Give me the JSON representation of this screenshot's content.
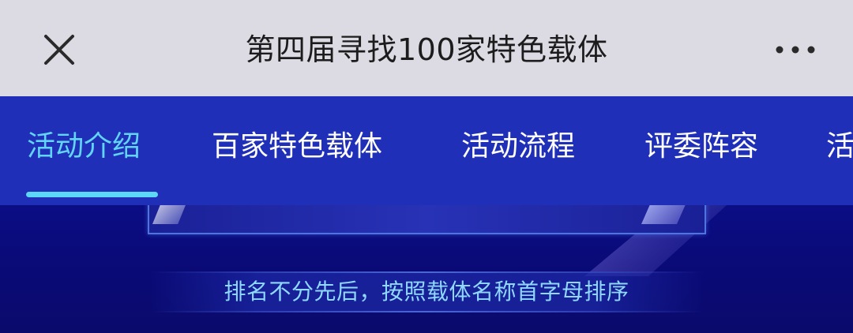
{
  "header": {
    "title": "第四届寻找100家特色载体",
    "close_icon": "close-icon",
    "more_icon": "more-horizontal-icon"
  },
  "tabs": [
    {
      "label": "活动介绍",
      "active": true
    },
    {
      "label": "百家特色载体",
      "active": false
    },
    {
      "label": "活动流程",
      "active": false
    },
    {
      "label": "评委阵容",
      "active": false
    },
    {
      "label": "活",
      "active": false
    }
  ],
  "banner": {
    "notice": "排名不分先后，按照载体名称首字母排序"
  },
  "colors": {
    "titlebar_bg": "#dcdbe3",
    "tabbar_bg": "#1f2fb7",
    "active_tab": "#62d4f5",
    "banner_bg": "#0b0b73",
    "notice_text": "#8fd8ff"
  }
}
